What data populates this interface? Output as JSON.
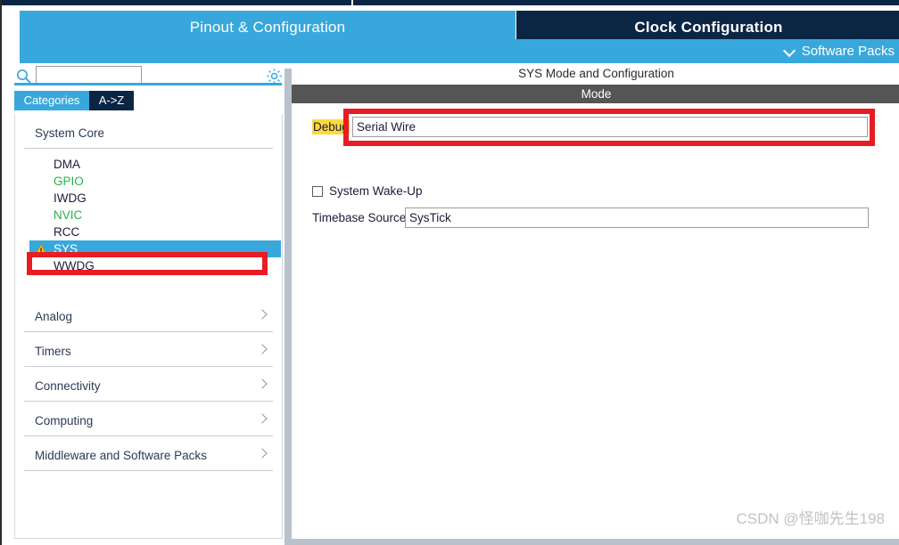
{
  "tabs": [
    {
      "label": "Pinout & Configuration",
      "active": true
    },
    {
      "label": "Clock Configuration",
      "active": false
    }
  ],
  "software_packs": {
    "label": "Software Packs",
    "chevron_icon": "chevron-down-icon"
  },
  "sidebar": {
    "search": {
      "value": "",
      "placeholder": "",
      "icon": "search-icon"
    },
    "settings_icon": "gear-icon",
    "view_tabs": [
      {
        "label": "Categories",
        "active": true
      },
      {
        "label": "A->Z",
        "active": false
      }
    ],
    "groups": [
      {
        "label": "System Core",
        "expanded": true,
        "items": [
          {
            "label": "DMA",
            "state": "default"
          },
          {
            "label": "GPIO",
            "state": "configured"
          },
          {
            "label": "IWDG",
            "state": "default"
          },
          {
            "label": "NVIC",
            "state": "configured"
          },
          {
            "label": "RCC",
            "state": "default"
          },
          {
            "label": "SYS",
            "state": "selected",
            "warning_icon": "warning-triangle-icon"
          },
          {
            "label": "WWDG",
            "state": "default"
          }
        ]
      },
      {
        "label": "Analog",
        "expanded": false,
        "items": []
      },
      {
        "label": "Timers",
        "expanded": false,
        "items": []
      },
      {
        "label": "Connectivity",
        "expanded": false,
        "items": []
      },
      {
        "label": "Computing",
        "expanded": false,
        "items": []
      },
      {
        "label": "Middleware and Software Packs",
        "expanded": false,
        "items": []
      }
    ]
  },
  "main": {
    "panel_title": "SYS Mode and Configuration",
    "mode_header": "Mode",
    "fields": {
      "debug_label": "Debug",
      "debug_value": "Serial Wire",
      "wakeup_label": "System Wake-Up",
      "wakeup_checked": false,
      "timebase_label": "Timebase Source",
      "timebase_value": "SysTick"
    }
  },
  "watermark": "CSDN @怪咖先生198",
  "colors": {
    "accent_blue": "#38a8dc",
    "dark_navy": "#0b2545",
    "annotation_red": "#e81c23",
    "highlight_yellow": "#ffd83d",
    "configured_green": "#26b34a",
    "mode_bar_grey": "#555555"
  }
}
